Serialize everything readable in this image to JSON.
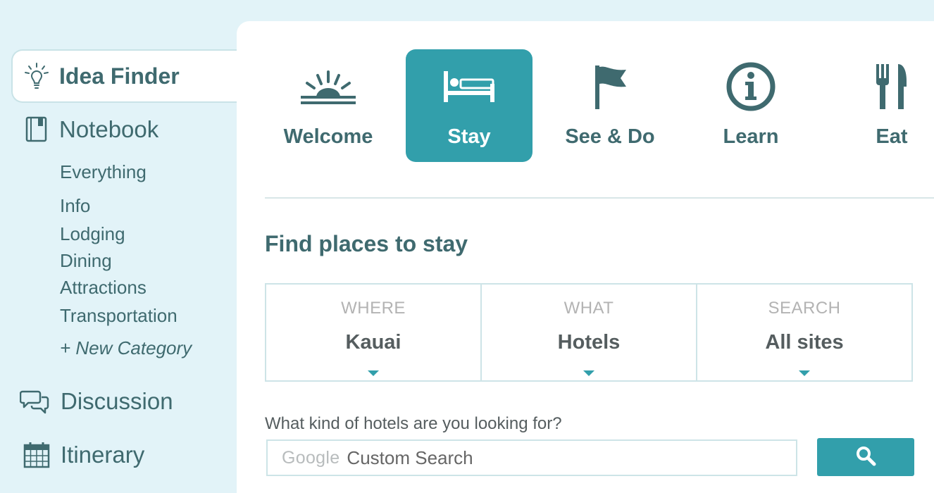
{
  "sidebar": {
    "idea_finder": {
      "label": "Idea Finder",
      "icon": "lightbulb-icon"
    },
    "notebook": {
      "label": "Notebook",
      "icon": "notebook-icon",
      "categories": [
        "Everything",
        "Info",
        "Lodging",
        "Dining",
        "Attractions",
        "Transportation"
      ],
      "new_category": "+ New Category"
    },
    "discussion": {
      "label": "Discussion",
      "icon": "speech-bubbles-icon"
    },
    "itinerary": {
      "label": "Itinerary",
      "icon": "calendar-icon"
    }
  },
  "tabs": [
    {
      "label": "Welcome",
      "icon": "sunrise-icon",
      "active": false
    },
    {
      "label": "Stay",
      "icon": "bed-icon",
      "active": true
    },
    {
      "label": "See & Do",
      "icon": "flag-icon",
      "active": false
    },
    {
      "label": "Learn",
      "icon": "info-icon",
      "active": false
    },
    {
      "label": "Eat",
      "icon": "fork-knife-icon",
      "active": false
    }
  ],
  "main": {
    "title": "Find places to stay",
    "filters": [
      {
        "label": "WHERE",
        "value": "Kauai"
      },
      {
        "label": "WHAT",
        "value": "Hotels"
      },
      {
        "label": "SEARCH",
        "value": "All sites"
      }
    ],
    "question": "What kind of hotels are you looking for?",
    "search": {
      "logo_text": "Google",
      "placeholder": "Custom Search",
      "button_icon": "search-icon"
    }
  },
  "colors": {
    "background": "#e2f3f8",
    "accent": "#329fab",
    "text": "#3f6a6f"
  }
}
